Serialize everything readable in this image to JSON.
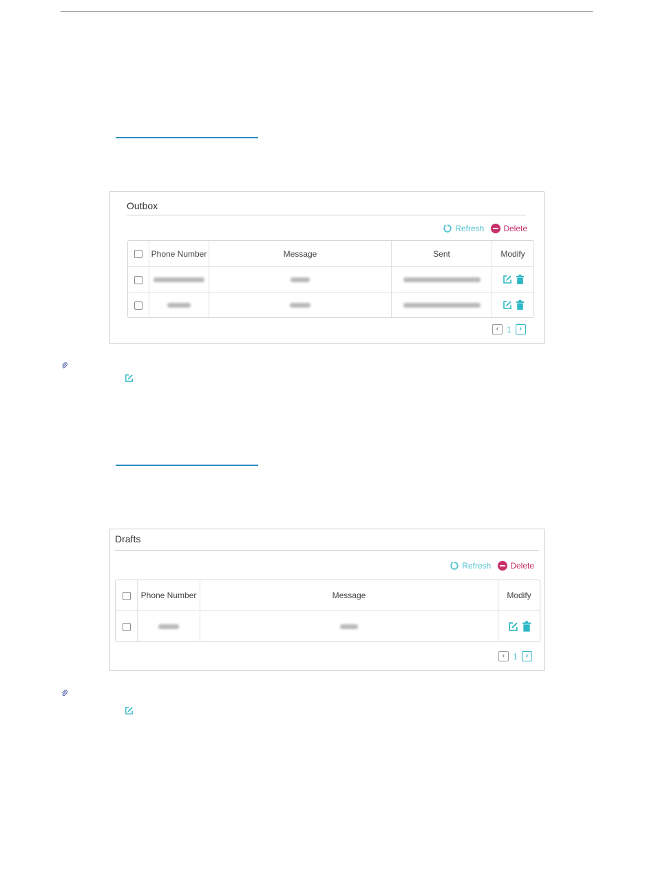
{
  "outbox": {
    "title": "Outbox",
    "refresh_label": "Refresh",
    "delete_label": "Delete",
    "columns": {
      "phone": "Phone Number",
      "message": "Message",
      "sent": "Sent",
      "modify": "Modify"
    },
    "page": "1"
  },
  "drafts": {
    "title": "Drafts",
    "refresh_label": "Refresh",
    "delete_label": "Delete",
    "columns": {
      "phone": "Phone Number",
      "message": "Message",
      "modify": "Modify"
    },
    "page": "1"
  },
  "colors": {
    "accent": "#4fc2cf",
    "delete": "#c8306a",
    "link_rule": "#2b8fc2"
  },
  "icons": [
    "refresh-icon",
    "delete-circle-icon",
    "edit-icon",
    "trash-icon",
    "chevron-left-icon",
    "chevron-right-icon",
    "paperclip-note-icon"
  ]
}
